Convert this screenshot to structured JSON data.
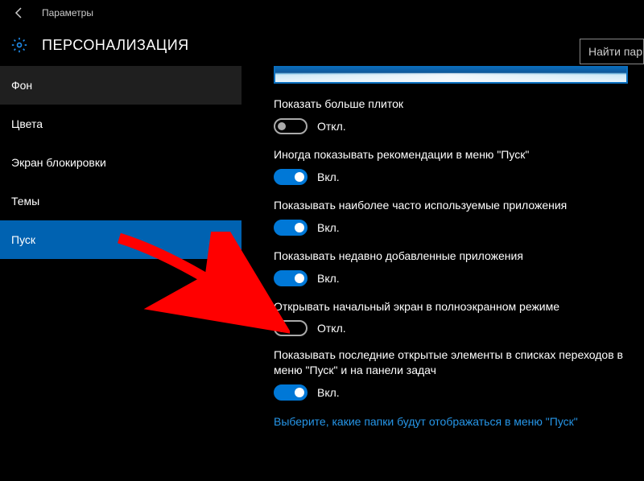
{
  "header": {
    "breadcrumb": "Параметры"
  },
  "title": "ПЕРСОНАЛИЗАЦИЯ",
  "search": {
    "placeholder": "Найти пар"
  },
  "sidebar": {
    "items": [
      {
        "label": "Фон"
      },
      {
        "label": "Цвета"
      },
      {
        "label": "Экран блокировки"
      },
      {
        "label": "Темы"
      },
      {
        "label": "Пуск"
      }
    ]
  },
  "main": {
    "settings": [
      {
        "label": "Показать больше плиток",
        "on": false
      },
      {
        "label": "Иногда показывать рекомендации в меню \"Пуск\"",
        "on": true
      },
      {
        "label": "Показывать наиболее часто используемые приложения",
        "on": true
      },
      {
        "label": "Показывать недавно добавленные приложения",
        "on": true
      },
      {
        "label": "Открывать начальный экран в полноэкранном режиме",
        "on": false
      },
      {
        "label": "Показывать последние открытые элементы в списках переходов в меню \"Пуск\" и на панели задач",
        "on": true
      }
    ],
    "state_on": "Вкл.",
    "state_off": "Откл.",
    "link": "Выберите, какие папки будут отображаться в меню \"Пуск\""
  }
}
